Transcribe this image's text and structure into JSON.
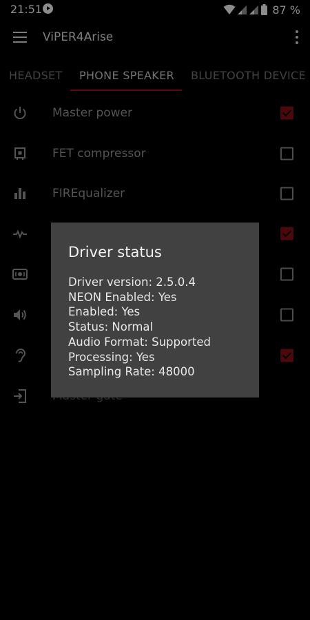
{
  "status_bar": {
    "time": "21:51",
    "battery_percent": "87 %",
    "icons": [
      "play-icon",
      "wifi-icon",
      "signal-icon",
      "signal-icon",
      "battery-icon"
    ]
  },
  "app_bar": {
    "title": "ViPER4Arise"
  },
  "tabs": [
    {
      "label": "HEADSET",
      "active": false
    },
    {
      "label": "PHONE SPEAKER",
      "active": true
    },
    {
      "label": "BLUETOOTH DEVICE",
      "active": false
    }
  ],
  "colors": {
    "accent": "#b2141c",
    "checkbox_checked": "#8a0f14",
    "dialog_bg": "#414141"
  },
  "effects": [
    {
      "label": "Master power",
      "icon": "power-icon",
      "checked": true
    },
    {
      "label": "FET compressor",
      "icon": "chip-icon",
      "checked": false
    },
    {
      "label": "FIREqualizer",
      "icon": "equalizer-icon",
      "checked": false
    },
    {
      "label": "",
      "icon": "waveform-icon",
      "checked": true
    },
    {
      "label": "",
      "icon": "surround-icon",
      "checked": false
    },
    {
      "label": "",
      "icon": "speaker-icon",
      "checked": false
    },
    {
      "label": "",
      "icon": "ear-icon",
      "checked": true
    },
    {
      "label": "Master gate",
      "icon": "input-icon",
      "checked": null
    }
  ],
  "dialog": {
    "title": "Driver status",
    "lines": [
      "Driver version: 2.5.0.4",
      "NEON Enabled: Yes",
      "Enabled: Yes",
      "Status: Normal",
      "Audio Format: Supported",
      "Processing: Yes",
      "Sampling Rate: 48000"
    ]
  }
}
